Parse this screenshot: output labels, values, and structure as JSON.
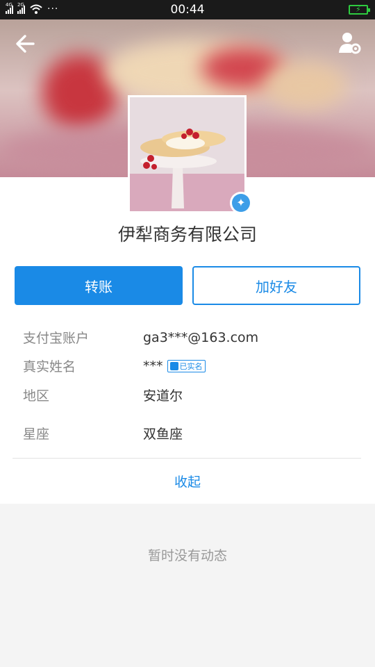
{
  "status_bar": {
    "network_1": "4G",
    "network_2": "2G",
    "more": "···",
    "time": "00:44"
  },
  "header": {
    "back_icon": "arrow-left-icon",
    "settings_icon": "user-settings-icon"
  },
  "profile": {
    "name": "伊犁商务有限公司",
    "verified_icon": "verified-star-icon"
  },
  "actions": {
    "transfer_label": "转账",
    "add_friend_label": "加好友"
  },
  "info": {
    "account_label": "支付宝账户",
    "account_value": "ga3***@163.com",
    "realname_label": "真实姓名",
    "realname_value": "***",
    "realname_tag": "已实名",
    "region_label": "地区",
    "region_value": "安道尔",
    "zodiac_label": "星座",
    "zodiac_value": "双鱼座"
  },
  "collapse_label": "收起",
  "feed": {
    "empty_message": "暂时没有动态"
  },
  "colors": {
    "accent": "#1a8ae6",
    "battery": "#2ecc40"
  }
}
